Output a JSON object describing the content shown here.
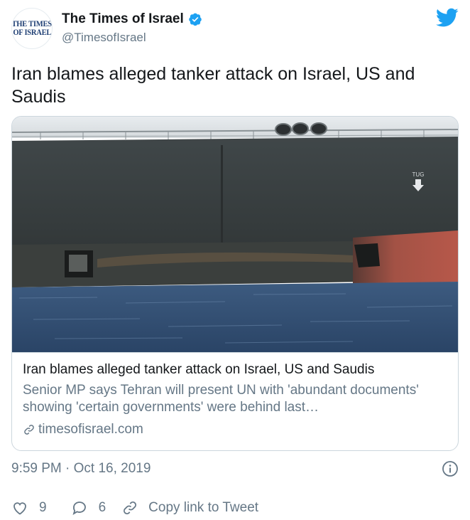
{
  "account": {
    "avatar_line1": "THE TIMES",
    "avatar_line2": "OF ISRAEL",
    "display_name": "The Times of Israel",
    "handle": "@TimesofIsrael",
    "verified": true
  },
  "tweet": {
    "text": "Iran blames alleged tanker attack on Israel, US and Saudis"
  },
  "card": {
    "image": "tanker-hull-photo",
    "title": "Iran blames alleged tanker attack on Israel, US and Saudis",
    "description": "Senior MP says Tehran will present UN with 'abundant documents' showing 'certain governments' were behind last…",
    "domain": "timesofisrael.com",
    "hull_marking": "TUG"
  },
  "meta": {
    "timestamp": "9:59 PM · Oct 16, 2019"
  },
  "actions": {
    "likes": "9",
    "replies": "6",
    "copy_link_label": "Copy link to Tweet"
  },
  "colors": {
    "text_primary": "#14171a",
    "text_secondary": "#657786",
    "twitter_blue": "#1da1f2",
    "border": "#ccd6dd"
  },
  "icons": [
    "twitter-bird-icon",
    "verified-badge-icon",
    "link-icon",
    "info-icon",
    "heart-icon",
    "reply-bubble-icon",
    "copy-link-icon"
  ]
}
